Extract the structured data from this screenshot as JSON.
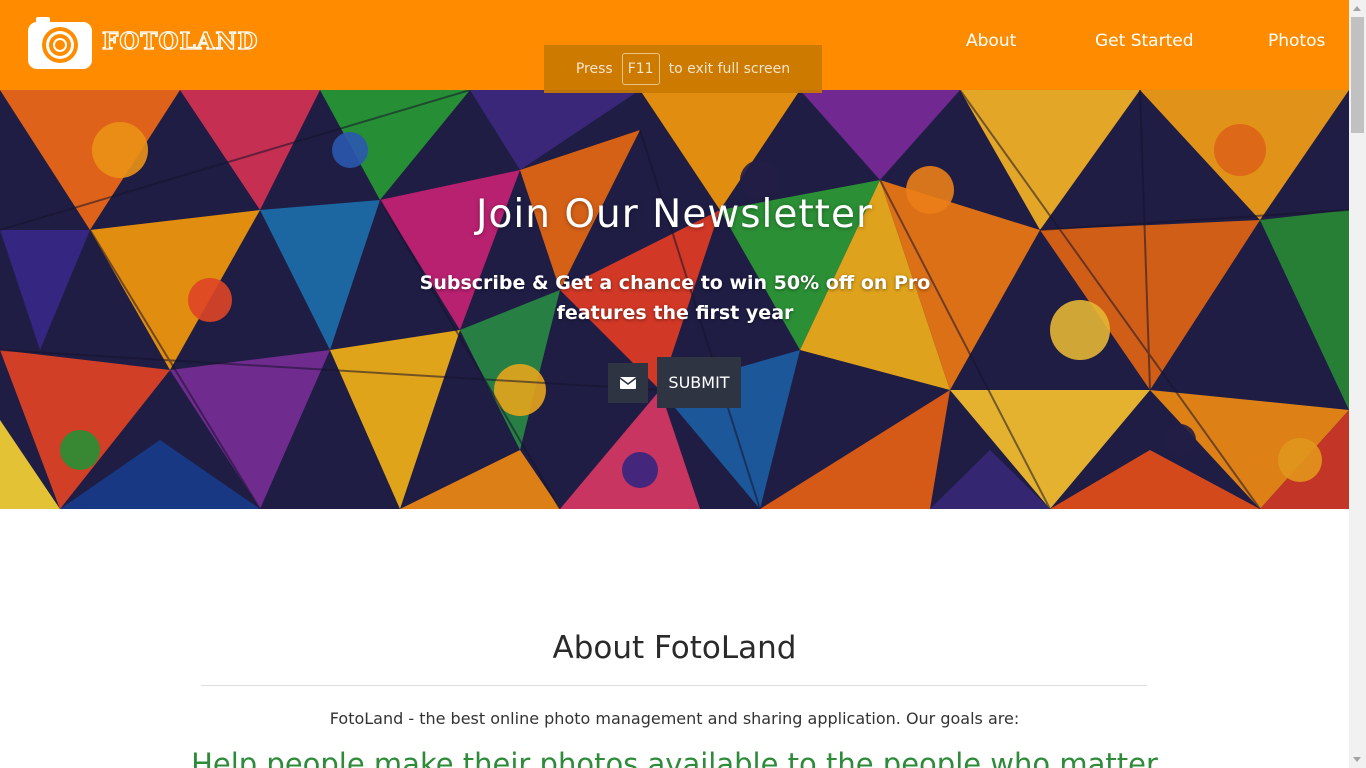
{
  "navbar": {
    "brand": "FOTOLAND",
    "links": [
      "About",
      "Get Started",
      "Photos"
    ],
    "background_color": "#ff8c00",
    "logo_icon": "camera-icon"
  },
  "fullscreen_notice": {
    "press": "Press",
    "key": "F11",
    "rest": "to exit full screen"
  },
  "hero": {
    "title": "Join Our Newsletter",
    "subtitle": "Subscribe & Get a chance to win 50% off on Pro features the first year",
    "email_icon": "envelope-icon",
    "submit_label": "SUBMIT",
    "button_color": "#2f3443"
  },
  "about": {
    "title": "About FotoLand",
    "description": "FotoLand - the best online photo management and sharing application. Our goals are:",
    "goal_1": "Help people make their photos available to the people who matter"
  }
}
